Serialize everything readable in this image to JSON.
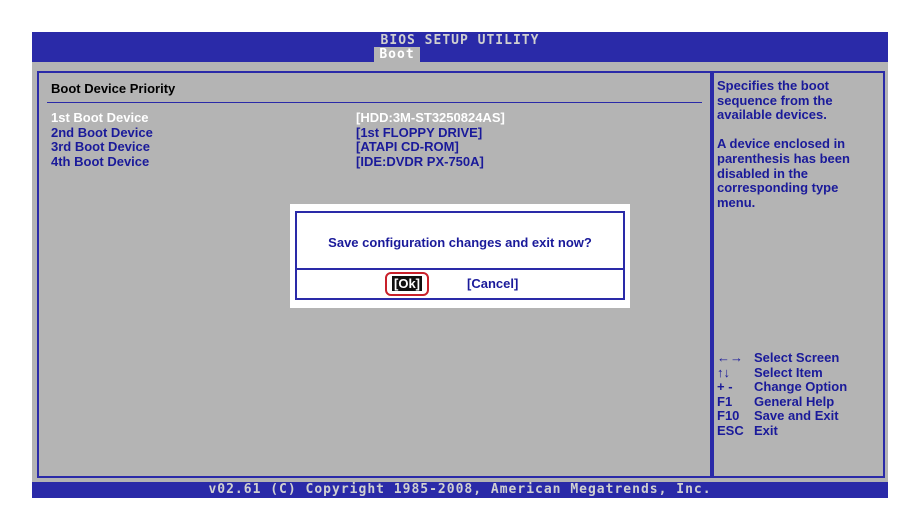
{
  "header": {
    "title": "BIOS SETUP UTILITY",
    "active_tab": "Boot"
  },
  "main": {
    "section_title": "Boot Device Priority",
    "rows": [
      {
        "label": "1st Boot Device",
        "value": "[HDD:3M-ST3250824AS]",
        "selected": true
      },
      {
        "label": "2nd Boot Device",
        "value": "[1st FLOPPY DRIVE]",
        "selected": false
      },
      {
        "label": "3rd Boot Device",
        "value": "[ATAPI CD-ROM]",
        "selected": false
      },
      {
        "label": "4th Boot Device",
        "value": "[IDE:DVDR PX-750A]",
        "selected": false
      }
    ]
  },
  "help": {
    "p1": "Specifies the boot sequence from the available devices.",
    "p2": "A device enclosed in parenthesis has been disabled in the corresponding type menu."
  },
  "keys": [
    {
      "key": "←→",
      "desc": "Select Screen"
    },
    {
      "key": "↑↓",
      "desc": "Select Item"
    },
    {
      "key": "+ -",
      "desc": "Change Option"
    },
    {
      "key": "F1",
      "desc": "General Help"
    },
    {
      "key": "F10",
      "desc": "Save and Exit"
    },
    {
      "key": "ESC",
      "desc": "Exit"
    }
  ],
  "dialog": {
    "message": "Save configuration changes and exit now?",
    "ok_label": "[Ok]",
    "cancel_label": "[Cancel]"
  },
  "footer": {
    "text": "v02.61 (C) Copyright 1985-2008, American Megatrends, Inc."
  },
  "colors": {
    "bios_blue": "#2a2aa8",
    "panel_gray": "#b4b4b4",
    "highlight_red": "#c8202a"
  }
}
